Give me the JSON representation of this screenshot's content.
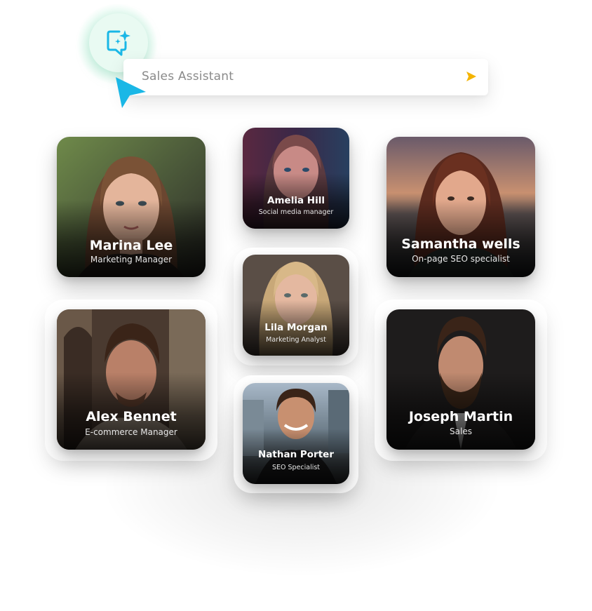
{
  "assistant": {
    "search_text": "Sales Assistant",
    "icon": "sparkle-note-icon",
    "send_icon": "send-arrow-icon",
    "cursor_icon": "pointer-cursor-icon",
    "accent": "#1ab7e6",
    "send_color": "#f4b400"
  },
  "profiles": [
    {
      "name": "Marina Lee",
      "role": "Marketing Manager"
    },
    {
      "name": "Amelia Hill",
      "role": "Social media manager"
    },
    {
      "name": "Samantha wells",
      "role": "On-page SEO specialist"
    },
    {
      "name": "Alex Bennet",
      "role": "E-commerce Manager"
    },
    {
      "name": "Lila Morgan",
      "role": "Marketing Analyst"
    },
    {
      "name": "Joseph Martin",
      "role": "Sales"
    },
    {
      "name": "Nathan Porter",
      "role": "SEO Specialist"
    }
  ]
}
